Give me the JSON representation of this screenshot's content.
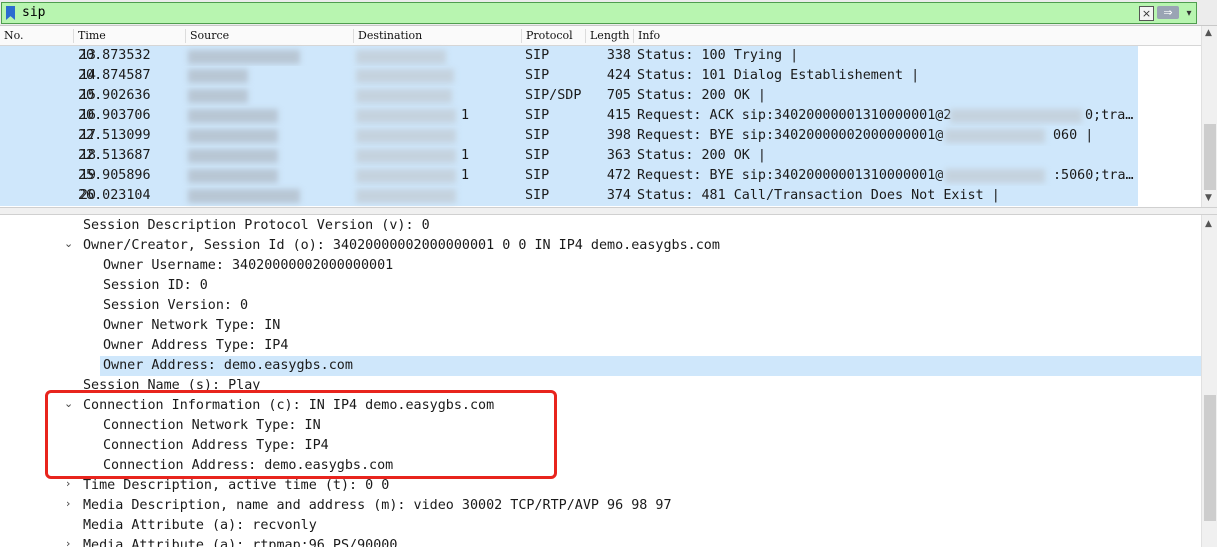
{
  "filter": {
    "value": "sip",
    "clear_icon": "×",
    "apply_icon": "⇒",
    "dropdown_icon": "▾"
  },
  "columns": [
    "No.",
    "Time",
    "Source",
    "Destination",
    "Protocol",
    "Length",
    "Info"
  ],
  "packets": [
    {
      "no": "13",
      "time": "20.873532",
      "protocol": "SIP",
      "length": "338",
      "info": "Status: 100 Trying |"
    },
    {
      "no": "14",
      "time": "20.874587",
      "protocol": "SIP",
      "length": "424",
      "info": "Status: 101 Dialog Establishement |"
    },
    {
      "no": "15",
      "time": "20.902636",
      "protocol": "SIP/SDP",
      "length": "705",
      "info": "Status: 200 OK |"
    },
    {
      "no": "16",
      "time": "20.903706",
      "dst_suffix": "1",
      "protocol": "SIP",
      "length": "415",
      "info": "Request: ACK sip:34020000001310000001@2",
      "info_tail": "0;tra…"
    },
    {
      "no": "17",
      "time": "22.513099",
      "protocol": "SIP",
      "length": "398",
      "info": "Request: BYE sip:34020000002000000001@",
      "info_tail": "060 |"
    },
    {
      "no": "18",
      "time": "22.513687",
      "dst_suffix": "1",
      "protocol": "SIP",
      "length": "363",
      "info": "Status: 200 OK |"
    },
    {
      "no": "19",
      "time": "25.905896",
      "dst_suffix": "1",
      "protocol": "SIP",
      "length": "472",
      "info": "Request: BYE sip:34020000001310000001@",
      "info_tail": ":5060;tra…"
    },
    {
      "no": "20",
      "time": "26.023104",
      "protocol": "SIP",
      "length": "374",
      "info": "Status: 481 Call/Transaction Does Not Exist |"
    }
  ],
  "details": [
    {
      "text": "Session Description Protocol Version (v): 0",
      "arrow": ""
    },
    {
      "text": "Owner/Creator, Session Id (o): 34020000002000000001 0 0 IN IP4 demo.easygbs.com",
      "arrow": "⌄"
    },
    {
      "text": "Owner Username: 34020000002000000001",
      "arrow": ""
    },
    {
      "text": "Session ID: 0",
      "arrow": ""
    },
    {
      "text": "Session Version: 0",
      "arrow": ""
    },
    {
      "text": "Owner Network Type: IN",
      "arrow": ""
    },
    {
      "text": "Owner Address Type: IP4",
      "arrow": ""
    },
    {
      "text": "Owner Address: demo.easygbs.com",
      "arrow": ""
    },
    {
      "text": "Session Name (s): Play",
      "arrow": ""
    },
    {
      "text": "Connection Information (c): IN IP4 demo.easygbs.com",
      "arrow": "⌄"
    },
    {
      "text": "Connection Network Type: IN",
      "arrow": ""
    },
    {
      "text": "Connection Address Type: IP4",
      "arrow": ""
    },
    {
      "text": "Connection Address: demo.easygbs.com",
      "arrow": ""
    },
    {
      "text": "Time Description, active time (t): 0 0",
      "arrow": "›"
    },
    {
      "text": "Media Description, name and address (m): video 30002 TCP/RTP/AVP 96 98 97",
      "arrow": "›"
    },
    {
      "text": "Media Attribute (a): recvonly",
      "arrow": ""
    },
    {
      "text": "Media Attribute (a): rtpmap:96 PS/90000",
      "arrow": "›"
    }
  ],
  "colors": {
    "selection": "#cfe7fb",
    "filter_valid": "#b8f5b0",
    "annotation_box": "#e8241d"
  }
}
